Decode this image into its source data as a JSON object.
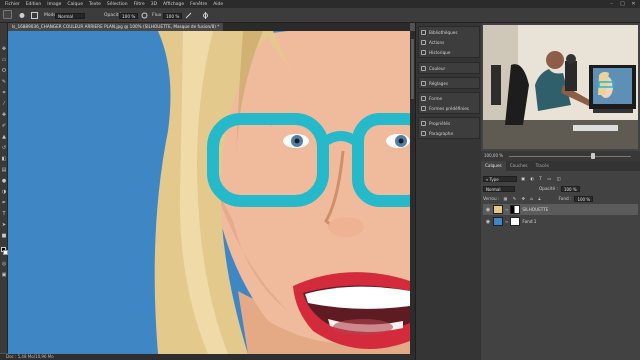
{
  "menubar": {
    "items": [
      "Fichier",
      "Edition",
      "Image",
      "Calque",
      "Texte",
      "Sélection",
      "Filtre",
      "3D",
      "Affichage",
      "Fenêtre",
      "Aide"
    ],
    "min": "–",
    "max": "□",
    "close": "✕"
  },
  "options": {
    "mode_label": "Mode :",
    "mode_value": "Normal",
    "opacity_label": "Opacité :",
    "opacity_value": "100 %",
    "flux_label": "Flux :",
    "flux_value": "100 %"
  },
  "document": {
    "tab_title": "ls_16889036_CHANGER COULEUR ARRIERE PLAN.jpg @ 100% (SILHOUETTE, Masque de fusion/8) *",
    "status": "Doc : 5,48 Mo/10,96 Mo"
  },
  "dock": {
    "group1": [
      "Bibliothèques",
      "Actions",
      "Historique"
    ],
    "group2": [
      "Couleur"
    ],
    "group3": [
      "Réglages"
    ],
    "group4": [
      "Forme",
      "Formes prédéfinies"
    ],
    "group5": [
      "Propriétés",
      "Paragraphe"
    ]
  },
  "navigator": {
    "zoom": "100,00 %"
  },
  "layers": {
    "tabs": [
      "Calques",
      "Couches",
      "Tracés"
    ],
    "filter": "Type",
    "blend": "Normal",
    "opacity_label": "Opacité :",
    "opacity_value": "100 %",
    "lock_label": "Verrou :",
    "fill_label": "Fond :",
    "fill_value": "100 %",
    "items": [
      {
        "name": "SILHOUETTE",
        "selected": true
      },
      {
        "name": "Fond 1",
        "selected": false
      }
    ]
  },
  "colors": {
    "canvas_bg": "#3f86c4",
    "glasses": "#25b9c9",
    "lips": "#d42b3c"
  }
}
